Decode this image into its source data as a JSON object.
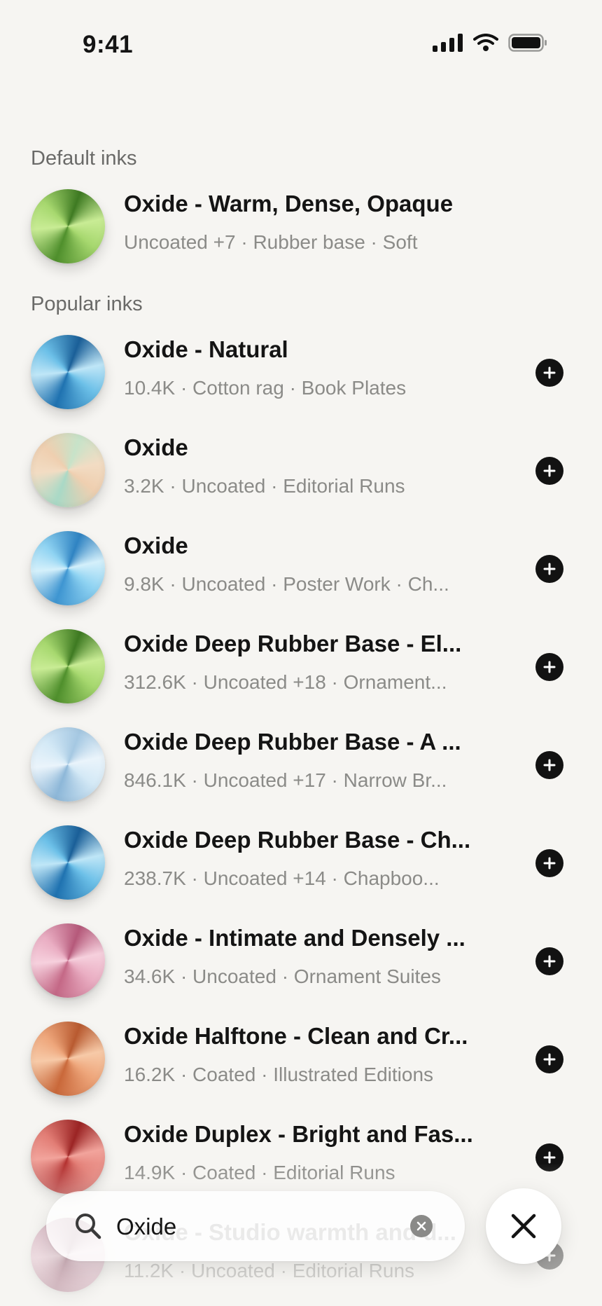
{
  "status_bar": {
    "time": "9:41",
    "icons": [
      "signal-icon",
      "wifi-icon",
      "battery-icon"
    ]
  },
  "search": {
    "query": "Oxide",
    "placeholder": "Search"
  },
  "sections": {
    "default_label": "Default inks",
    "popular_label": "Popular inks"
  },
  "default_inks": [
    {
      "title": "Oxide - Warm, Dense, Opaque",
      "subtitle": "Uncoated +7 · Rubber base · Soft",
      "swatch": "green"
    }
  ],
  "popular_inks": [
    {
      "title": "Oxide - Natural",
      "subtitle": "10.4K · Cotton rag · Book Plates",
      "swatch": "blue"
    },
    {
      "title": "Oxide",
      "subtitle": "3.2K · Uncoated · Editorial Runs",
      "swatch": "pastel"
    },
    {
      "title": "Oxide",
      "subtitle": "9.8K · Uncoated · Poster Work · Ch...",
      "swatch": "sky"
    },
    {
      "title": "Oxide Deep Rubber Base - El...",
      "subtitle": "312.6K · Uncoated +18 · Ornament...",
      "swatch": "green"
    },
    {
      "title": "Oxide Deep Rubber Base - A ...",
      "subtitle": "846.1K · Uncoated +17 · Narrow Br...",
      "swatch": "paleblue"
    },
    {
      "title": "Oxide Deep Rubber Base - Ch...",
      "subtitle": "238.7K · Uncoated +14 · Chapboo...",
      "swatch": "blue"
    },
    {
      "title": "Oxide - Intimate and Densely ...",
      "subtitle": "34.6K · Uncoated · Ornament Suites",
      "swatch": "pink"
    },
    {
      "title": "Oxide Halftone - Clean and Cr...",
      "subtitle": "16.2K · Coated · Illustrated Editions",
      "swatch": "orange"
    },
    {
      "title": "Oxide Duplex - Bright and Fas...",
      "subtitle": "14.9K · Coated · Editorial Runs",
      "swatch": "red"
    },
    {
      "title": "Oxide - Studio warmth and d...",
      "subtitle": "11.2K · Uncoated · Editorial Runs",
      "swatch": "plum"
    }
  ],
  "colors": {
    "background": "#f6f5f2",
    "text_primary": "#141414",
    "text_secondary": "#8b8b88",
    "add_button": "#121212"
  }
}
